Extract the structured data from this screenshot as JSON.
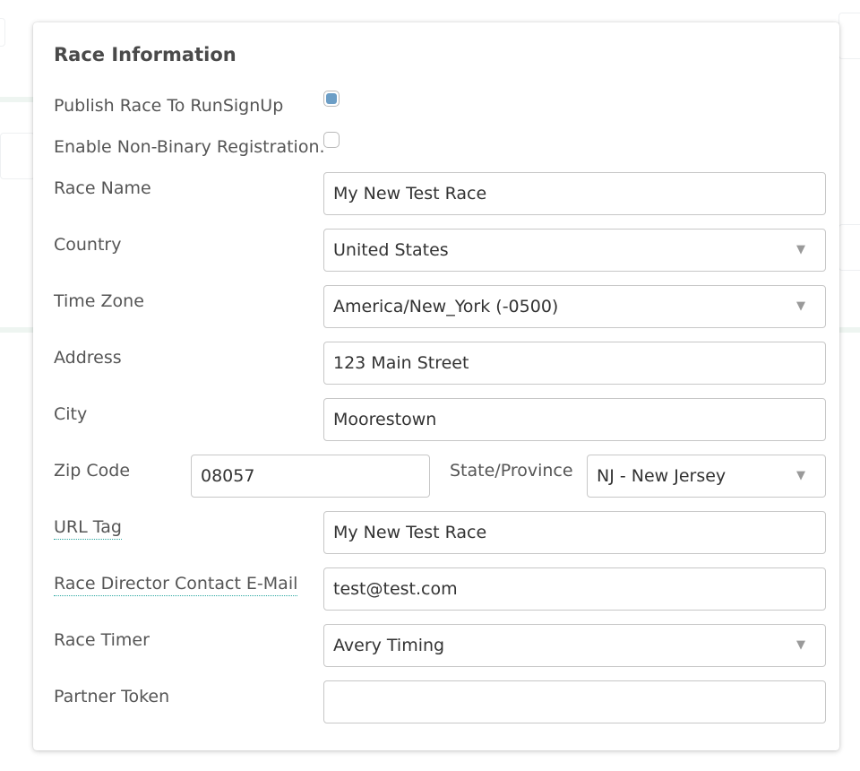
{
  "modal": {
    "title": "Race Information",
    "publish_label": "Publish Race To RunSignUp",
    "publish_checked": true,
    "nonbinary_label": "Enable Non-Binary Registration.",
    "nonbinary_checked": false,
    "fields": {
      "race_name": {
        "label": "Race Name",
        "value": "My New Test Race"
      },
      "country": {
        "label": "Country",
        "value": "United States"
      },
      "time_zone": {
        "label": "Time Zone",
        "value": "America/New_York (-0500)"
      },
      "address": {
        "label": "Address",
        "value": "123 Main Street"
      },
      "city": {
        "label": "City",
        "value": "Moorestown"
      },
      "zip": {
        "label": "Zip Code",
        "value": "08057"
      },
      "state": {
        "label": "State/Province",
        "value": "NJ - New Jersey"
      },
      "url_tag": {
        "label": "URL Tag",
        "value": "My New Test Race"
      },
      "email": {
        "label": "Race Director Contact E-Mail",
        "value": "test@test.com"
      },
      "race_timer": {
        "label": "Race Timer",
        "value": "Avery Timing"
      },
      "partner_token": {
        "label": "Partner Token",
        "value": ""
      }
    },
    "dropdown_arrow": "▼",
    "checkbox_accent": "#6c9ec6"
  }
}
